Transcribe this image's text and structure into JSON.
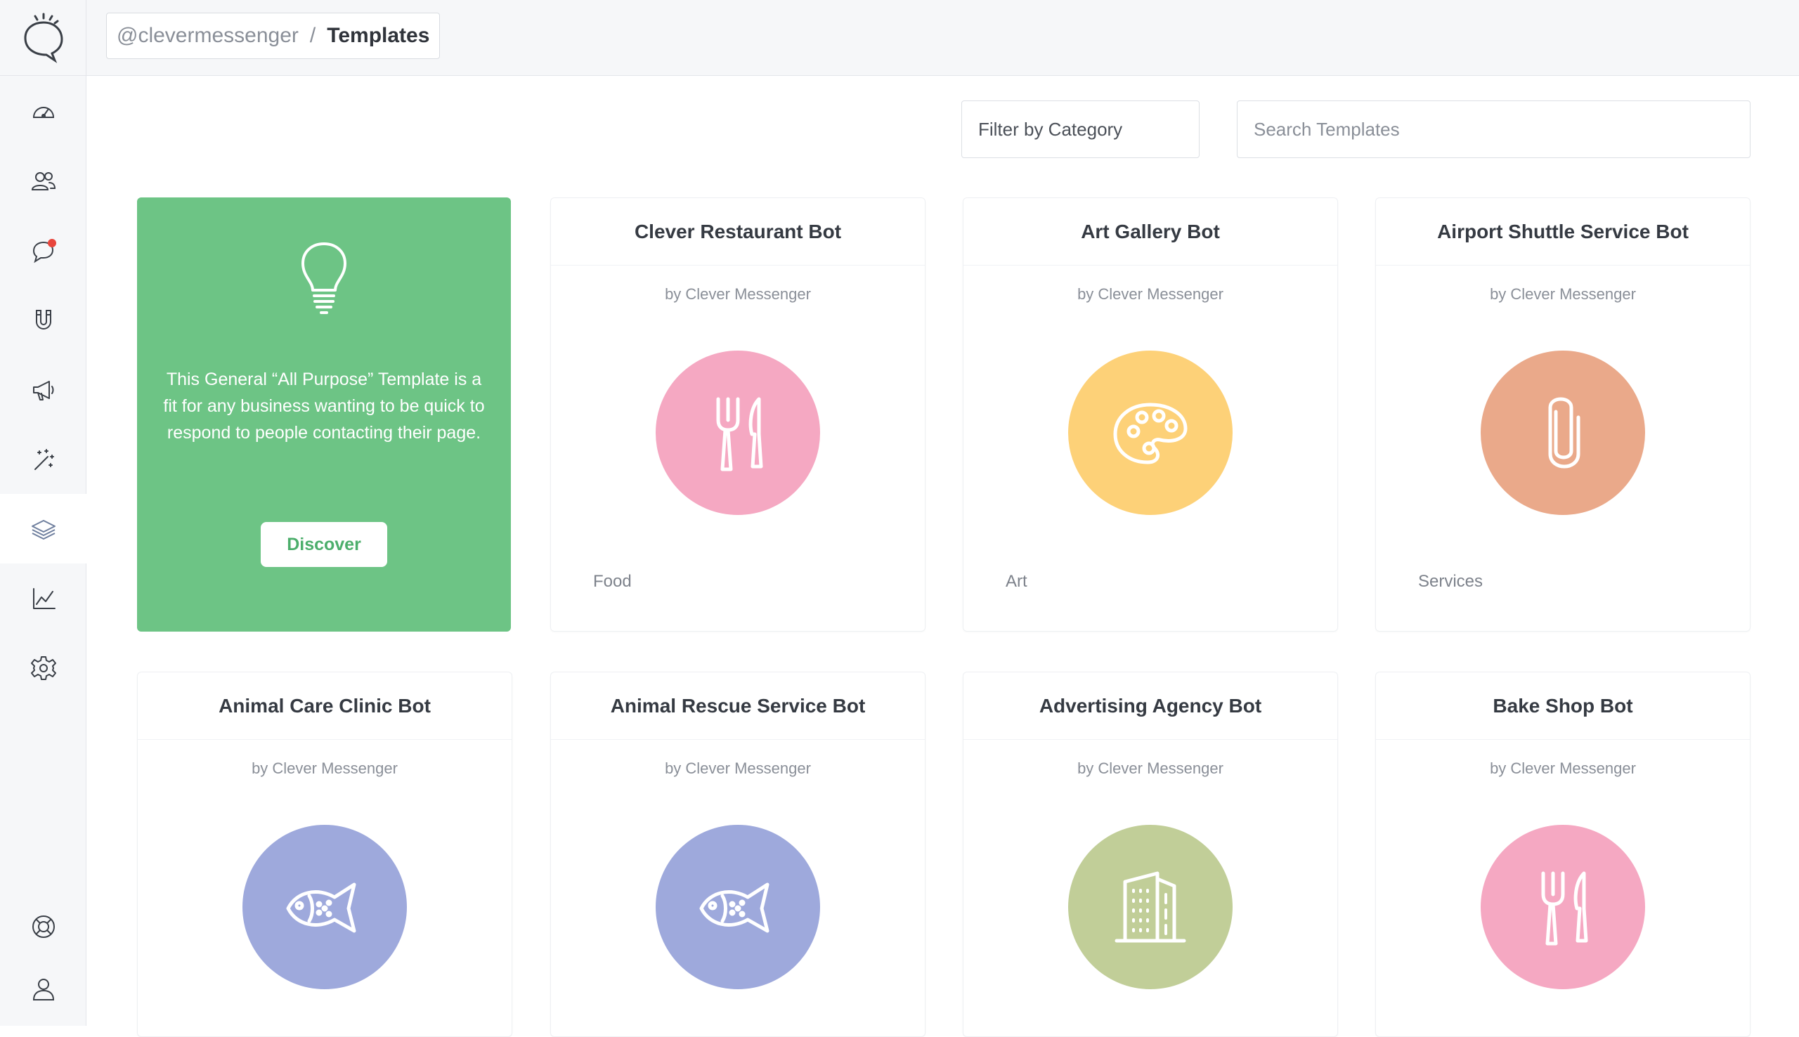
{
  "header": {
    "account": "@clevermessenger",
    "separator": "/",
    "page": "Templates"
  },
  "sidebar": {
    "items": [
      {
        "name": "dashboard",
        "icon": "speedometer-icon"
      },
      {
        "name": "audience",
        "icon": "users-icon",
        "badge": true
      },
      {
        "name": "live-chat",
        "icon": "chat-bubble-icon"
      },
      {
        "name": "growth-tools",
        "icon": "magnet-icon"
      },
      {
        "name": "broadcasts",
        "icon": "megaphone-icon"
      },
      {
        "name": "automation",
        "icon": "magic-wand-icon"
      },
      {
        "name": "templates",
        "icon": "layers-icon",
        "active": true
      },
      {
        "name": "analytics",
        "icon": "line-chart-icon"
      },
      {
        "name": "settings",
        "icon": "gear-icon"
      },
      {
        "name": "help",
        "icon": "lifebuoy-icon"
      },
      {
        "name": "profile",
        "icon": "user-icon"
      }
    ]
  },
  "toolbar": {
    "filter_label": "Filter by Category",
    "search_placeholder": "Search Templates"
  },
  "promo": {
    "text": "This General “All Purpose” Template is a fit for any business wanting to be quick to respond to people contacting their page.",
    "button_label": "Discover"
  },
  "templates": [
    {
      "title": "Clever Restaurant Bot",
      "author": "by Clever Messenger",
      "category": "Food",
      "icon": "fork-knife-icon",
      "color": "#f5a8c2"
    },
    {
      "title": "Art Gallery Bot",
      "author": "by Clever Messenger",
      "category": "Art",
      "icon": "palette-icon",
      "color": "#fdd178"
    },
    {
      "title": "Airport Shuttle Service Bot",
      "author": "by Clever Messenger",
      "category": "Services",
      "icon": "paperclip-icon",
      "color": "#eaa98a"
    },
    {
      "title": "Animal Care Clinic Bot",
      "author": "by Clever Messenger",
      "category": "",
      "icon": "fish-icon",
      "color": "#9ea9dc"
    },
    {
      "title": "Animal Rescue Service Bot",
      "author": "by Clever Messenger",
      "category": "",
      "icon": "fish-icon",
      "color": "#9ea9dc"
    },
    {
      "title": "Advertising Agency Bot",
      "author": "by Clever Messenger",
      "category": "",
      "icon": "building-icon",
      "color": "#c1ce98"
    },
    {
      "title": "Bake Shop Bot",
      "author": "by Clever Messenger",
      "category": "",
      "icon": "fork-knife-icon",
      "color": "#f5a8c2"
    }
  ],
  "colors": {
    "accent_green": "#6dc485",
    "notification_red": "#e8453c",
    "sidebar_bg": "#f6f7f9"
  }
}
